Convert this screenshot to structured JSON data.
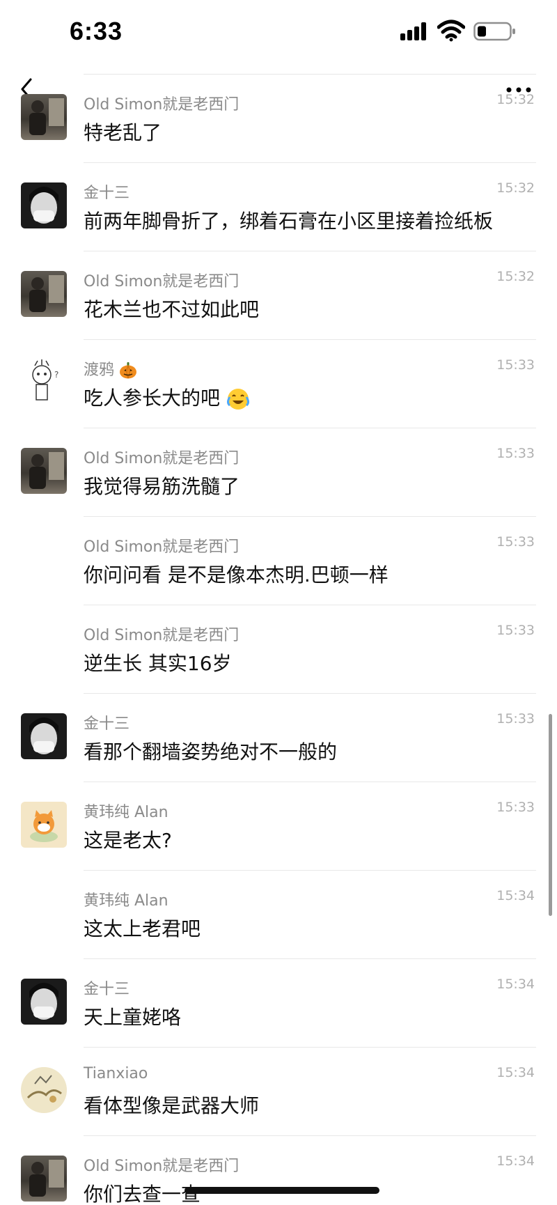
{
  "status_bar": {
    "time": "6:33",
    "icons": [
      "signal-icon",
      "wifi-icon",
      "battery-icon"
    ]
  },
  "header": {
    "icons": [
      "back-icon",
      "more-icon"
    ]
  },
  "messages": [
    {
      "sender": "Old Simon就是老西门",
      "time": "15:32",
      "text": "特老乱了",
      "avatar": "simon"
    },
    {
      "sender": "金十三",
      "time": "15:32",
      "text": "前两年脚骨折了，绑着石膏在小区里接着捡纸板",
      "avatar": "jin"
    },
    {
      "sender": "Old Simon就是老西门",
      "time": "15:32",
      "text": "花木兰也不过如此吧",
      "avatar": "simon"
    },
    {
      "sender": "渡鸦",
      "sender_emoji": "pumpkin-emoji",
      "time": "15:33",
      "text": "吃人参长大的吧",
      "text_emoji": "laughing-crying-emoji",
      "avatar": "duya"
    },
    {
      "sender": "Old Simon就是老西门",
      "time": "15:33",
      "text": "我觉得易筋洗髓了",
      "avatar": "simon"
    },
    {
      "sender": "Old Simon就是老西门",
      "time": "15:33",
      "text": "你问问看 是不是像本杰明.巴顿一样",
      "avatar": ""
    },
    {
      "sender": "Old Simon就是老西门",
      "time": "15:33",
      "text": "逆生长 其实16岁",
      "avatar": ""
    },
    {
      "sender": "金十三",
      "time": "15:33",
      "text": "看那个翻墙姿势绝对不一般的",
      "avatar": "jin"
    },
    {
      "sender": "黄玮纯 Alan",
      "time": "15:33",
      "text": "这是老太?",
      "avatar": "huang"
    },
    {
      "sender": "黄玮纯 Alan",
      "time": "15:34",
      "text": "这太上老君吧",
      "avatar": ""
    },
    {
      "sender": "金十三",
      "time": "15:34",
      "text": "天上童姥咯",
      "avatar": "jin"
    },
    {
      "sender": "Tianxiao",
      "time": "15:34",
      "text": "看体型像是武器大师",
      "avatar": "tianxiao"
    },
    {
      "sender": "Old Simon就是老西门",
      "time": "15:34",
      "text": "你们去查一查",
      "avatar": "simon"
    }
  ]
}
